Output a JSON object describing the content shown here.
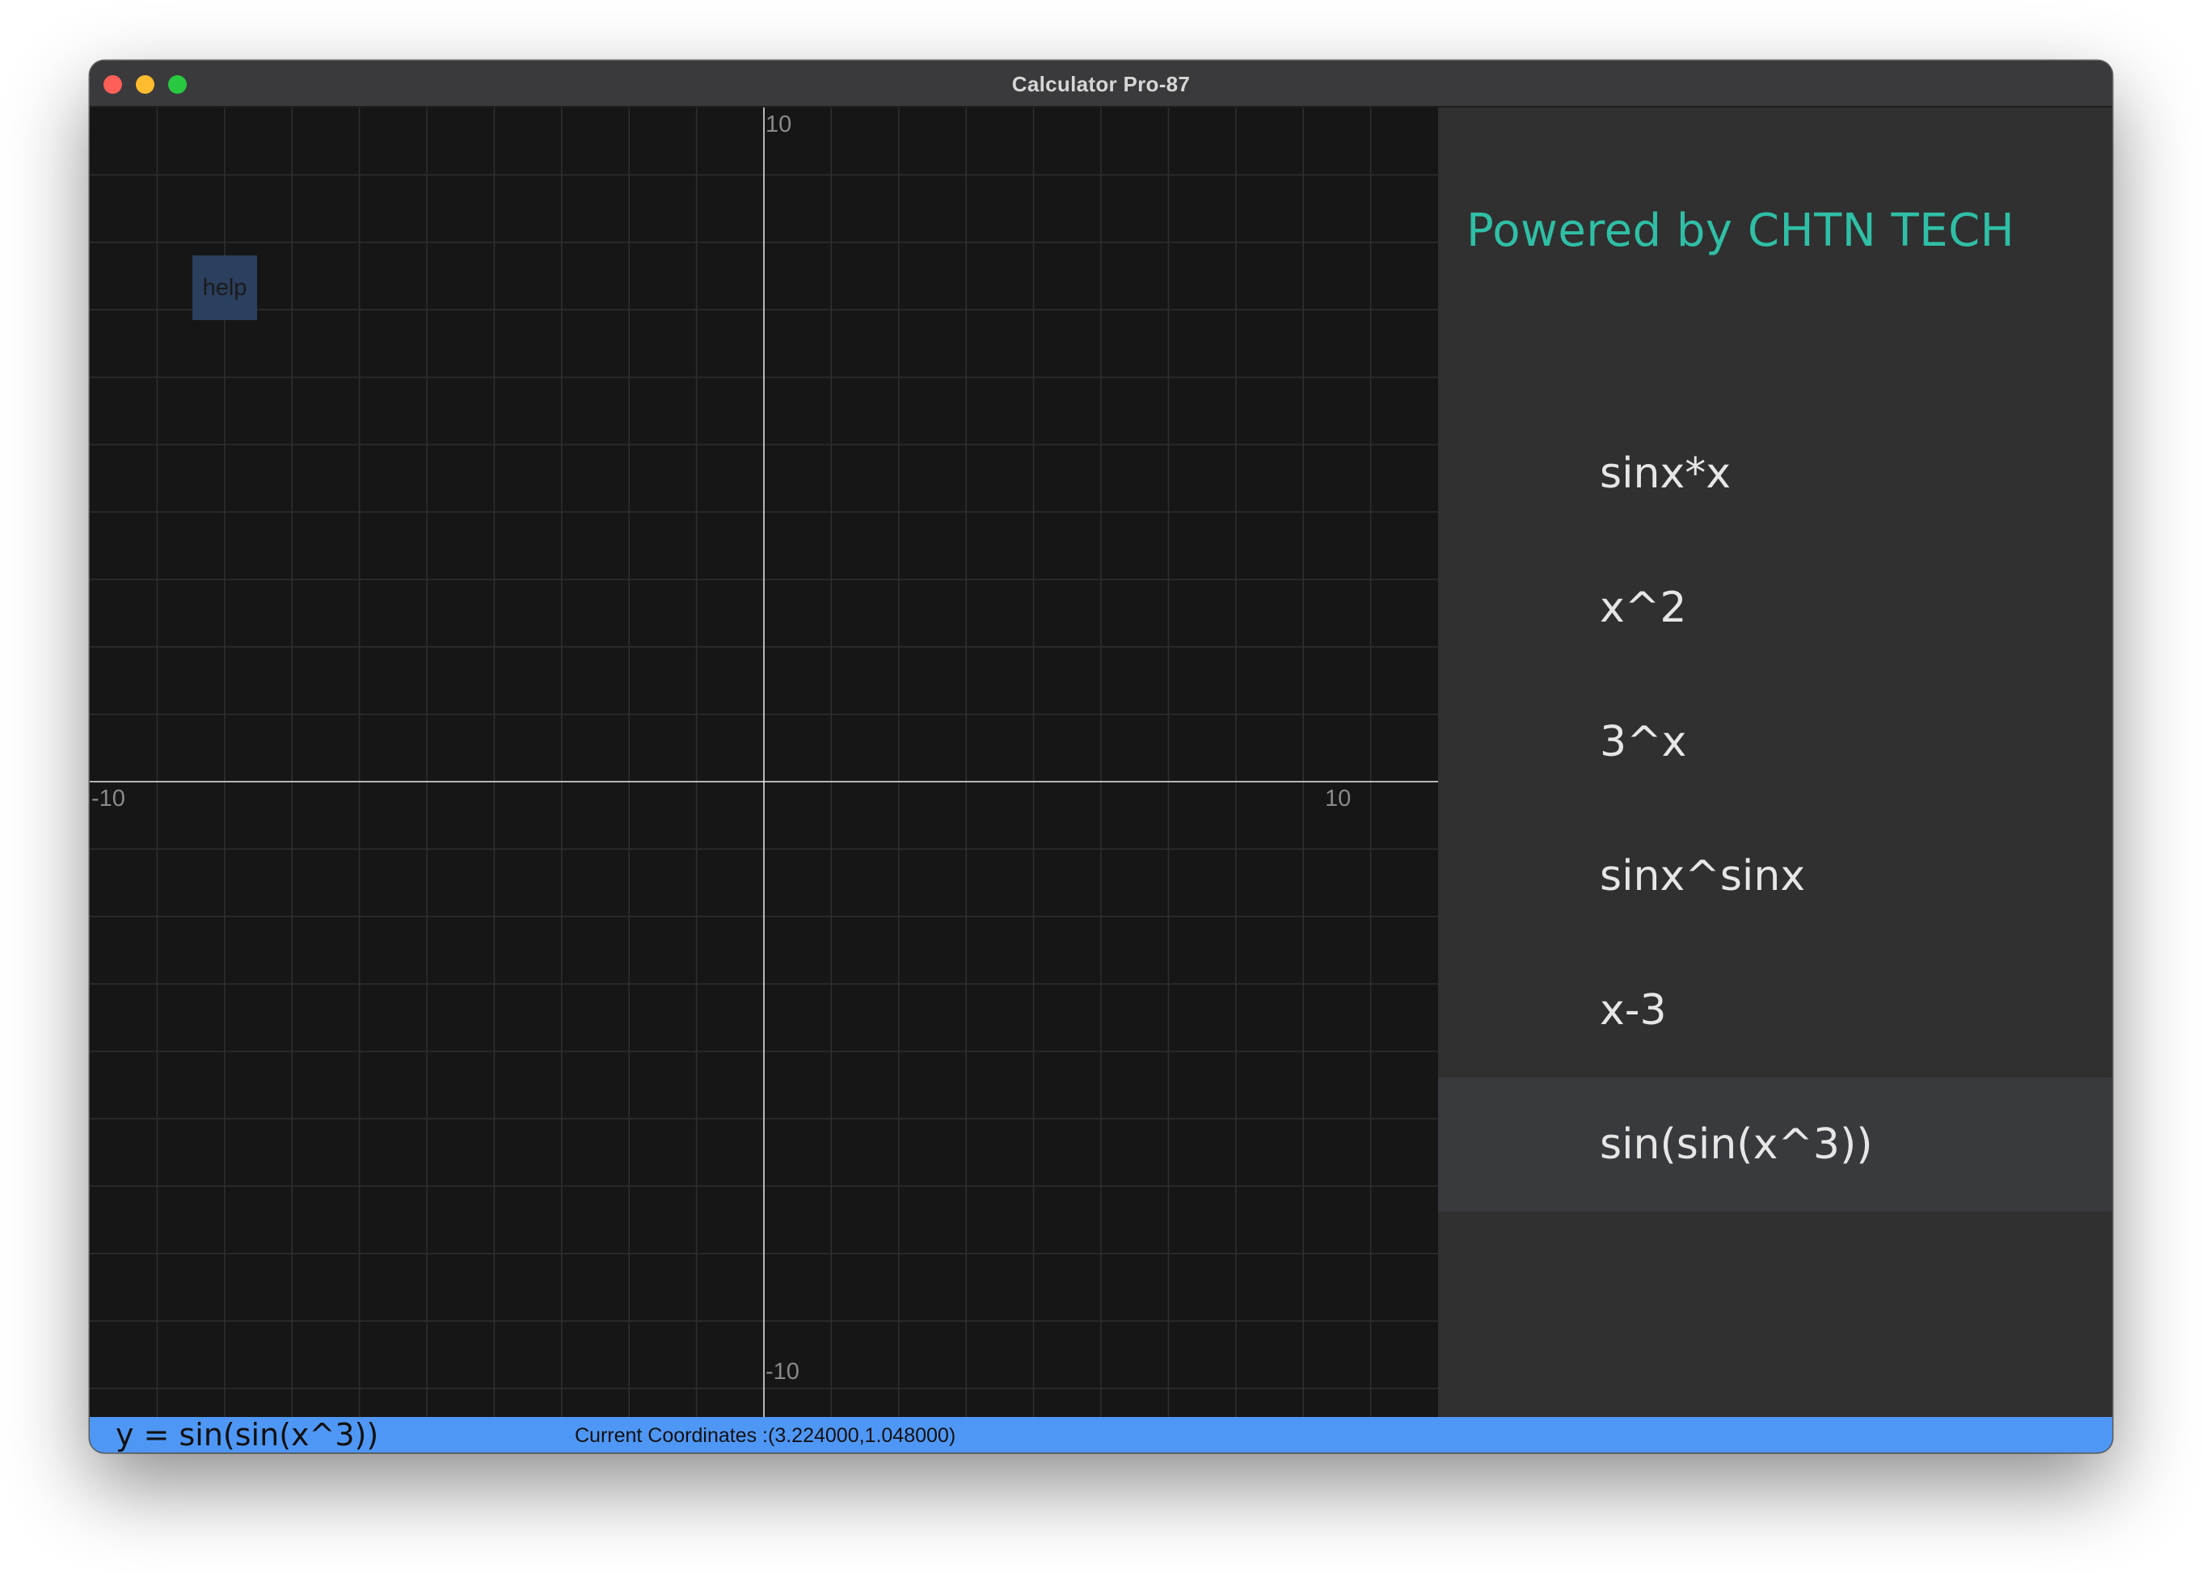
{
  "window": {
    "title": "Calculator Pro-87"
  },
  "graph": {
    "x_range": [
      -10,
      10
    ],
    "y_range": [
      -10,
      10
    ],
    "grid": true,
    "axis_labels": {
      "y_top": "10",
      "y_bottom": "-10",
      "x_left": "-10",
      "x_right": "10"
    },
    "help_label": "help"
  },
  "sidebar": {
    "brand": "Powered by CHTN TECH",
    "functions": [
      {
        "label": "sinx*x"
      },
      {
        "label": "x^2"
      },
      {
        "label": "3^x"
      },
      {
        "label": "sinx^sinx"
      },
      {
        "label": "x-3"
      },
      {
        "label": "sin(sin(x^3))"
      }
    ],
    "selected_index": 5
  },
  "statusbar": {
    "expression": "y = sin(sin(x^3))",
    "coordinates": "Current Coordinates :(3.224000,1.048000)"
  },
  "colors": {
    "brand": "#2fbfa6",
    "statusbar": "#4f97f5",
    "graph_background": "#161616",
    "sidebar_background": "#303030",
    "selected_item": "#393a3e"
  }
}
